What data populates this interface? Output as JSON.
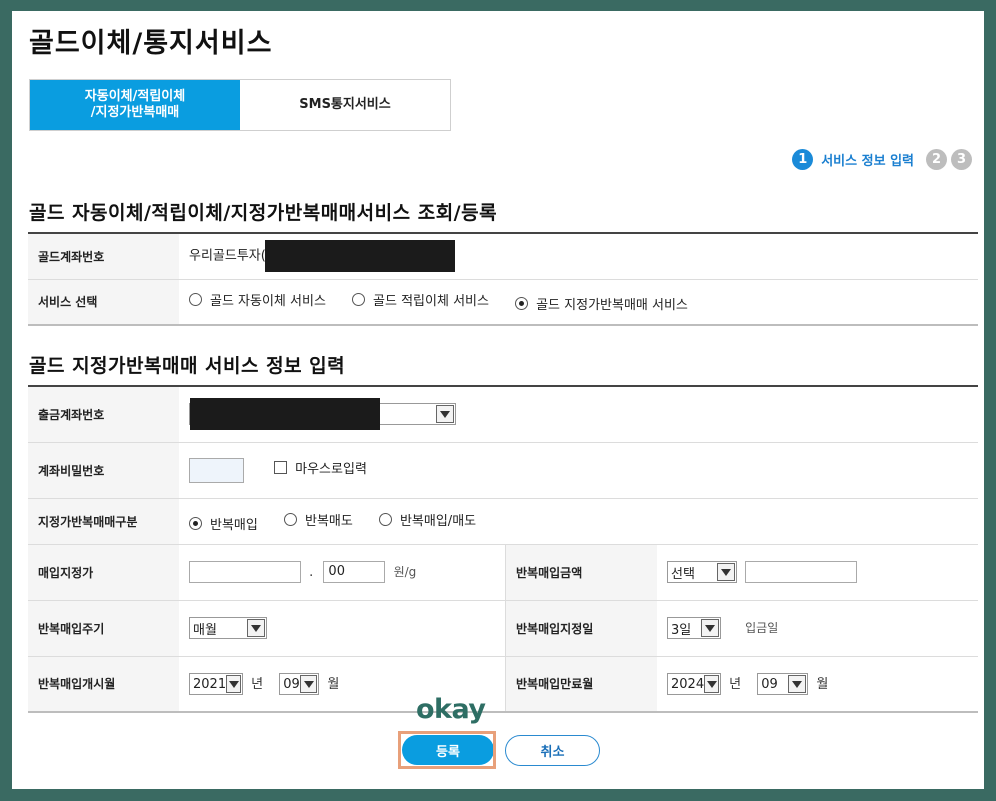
{
  "page": {
    "title": "골드이체/통지서비스"
  },
  "tabs": [
    {
      "label": "자동이체/적립이체\n/지정가반복매매"
    },
    {
      "label": "SMS통지서비스"
    }
  ],
  "steps": {
    "step1": "1",
    "step1_label": "서비스 정보 입력",
    "step2": "2",
    "step3": "3"
  },
  "section1": {
    "title": "골드 자동이체/적립이체/지정가반복매매서비스 조회/등록",
    "account_label": "골드계좌번호",
    "account_value": "우리골드투자(",
    "service_label": "서비스 선택",
    "service_options": [
      "골드 자동이체 서비스",
      "골드 적립이체 서비스",
      "골드 지정가반복매매 서비스"
    ],
    "service_selected": 2
  },
  "section2": {
    "title": "골드 지정가반복매매 서비스 정보 입력",
    "withdraw_label": "출금계좌번호",
    "password_label": "계좌비밀번호",
    "mouse_input_label": "마우스로입력",
    "trade_type_label": "지정가반복매매구분",
    "trade_type_options": [
      "반복매입",
      "반복매도",
      "반복매입/매도"
    ],
    "trade_type_selected": 0,
    "buy_price_label": "매입지정가",
    "buy_price_decimal": "00",
    "buy_price_unit": "원/g",
    "buy_amount_label": "반복매입금액",
    "buy_amount_select": "선택",
    "cycle_label": "반복매입주기",
    "cycle_select": "매월",
    "buy_day_label": "반복매입지정일",
    "buy_day_select": "3일",
    "buy_day_note": "입금일",
    "start_label": "반복매입개시월",
    "start_year": "2021",
    "start_year_unit": "년",
    "start_month": "09",
    "start_month_unit": "월",
    "end_label": "반복매입만료월",
    "end_year": "2024",
    "end_year_unit": "년",
    "end_month": "09",
    "end_month_unit": "월"
  },
  "buttons": {
    "submit": "등록",
    "cancel": "취소"
  },
  "overlay": {
    "okay_text": "okay"
  }
}
